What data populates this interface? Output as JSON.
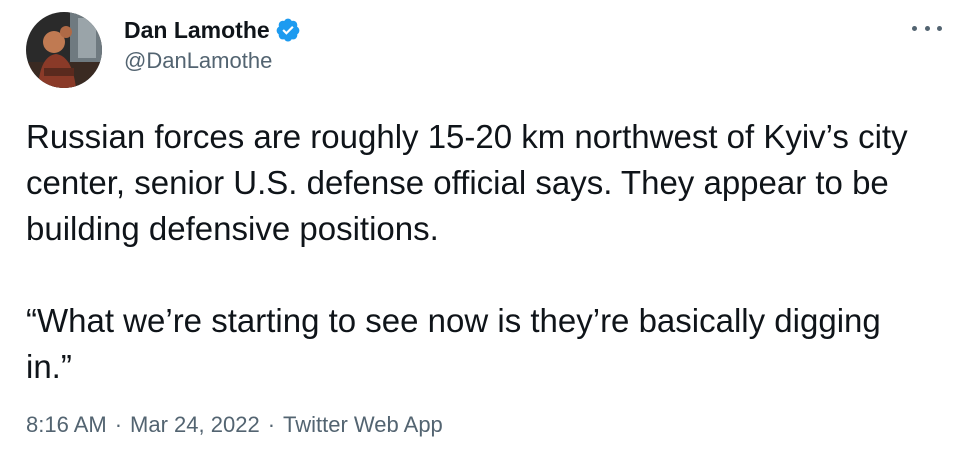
{
  "author": {
    "display_name": "Dan Lamothe",
    "handle": "@DanLamothe",
    "verified": true,
    "avatar_icon": "profile-photo"
  },
  "more_icon": "more-horizontal-icon",
  "tweet": {
    "paragraph_1": "Russian forces are roughly 15-20 km northwest of Kyiv’s city center, senior U.S. defense official says. They appear to be building defensive positions.",
    "paragraph_2": "“What we’re starting to see now is they’re basically digging in.”"
  },
  "meta": {
    "time": "8:16 AM",
    "separator": "·",
    "date": "Mar 24, 2022",
    "source": "Twitter Web App"
  },
  "colors": {
    "text": "#0f1419",
    "secondary": "#536471",
    "verified_badge": "#1d9bf0"
  }
}
